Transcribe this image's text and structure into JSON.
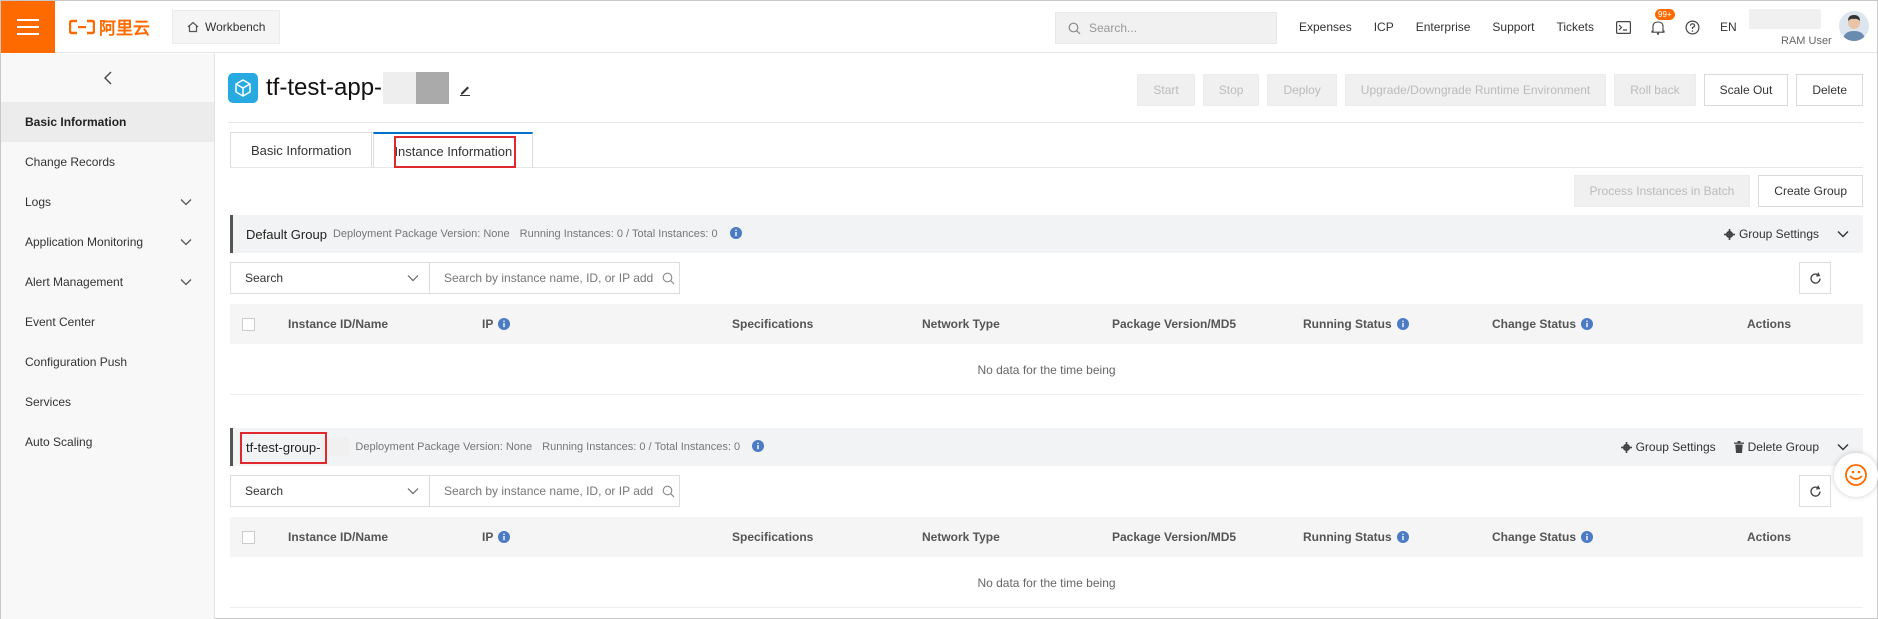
{
  "topbar": {
    "logo_text": "阿里云",
    "workbench": "Workbench",
    "search_placeholder": "Search...",
    "links": [
      "Expenses",
      "ICP",
      "Enterprise",
      "Support",
      "Tickets"
    ],
    "notification_badge": "99+",
    "language": "EN",
    "user_label": "RAM User",
    "brand_color": "#ff6a00"
  },
  "sidebar": {
    "items": [
      {
        "label": "Basic Information",
        "active": true
      },
      {
        "label": "Change Records"
      },
      {
        "label": "Logs",
        "expandable": true
      },
      {
        "label": "Application Monitoring",
        "expandable": true
      },
      {
        "label": "Alert Management",
        "expandable": true
      },
      {
        "label": "Event Center"
      },
      {
        "label": "Configuration Push"
      },
      {
        "label": "Services"
      },
      {
        "label": "Auto Scaling"
      }
    ]
  },
  "header": {
    "app_title": "tf-test-app-",
    "buttons": {
      "start": "Start",
      "stop": "Stop",
      "deploy": "Deploy",
      "upgrade": "Upgrade/Downgrade Runtime Environment",
      "rollback": "Roll back",
      "scale_out": "Scale Out",
      "delete": "Delete"
    }
  },
  "tabs": [
    {
      "label": "Basic Information"
    },
    {
      "label": "Instance Information",
      "active": true
    }
  ],
  "group_actions": {
    "process_batch": "Process Instances in Batch",
    "create_group": "Create Group"
  },
  "groups": [
    {
      "name": "Default Group",
      "package_version": "Deployment Package Version: None",
      "instances": "Running Instances: 0 / Total Instances: 0",
      "settings": "Group Settings",
      "filter_select": "Search",
      "filter_placeholder": "Search by instance name, ID, or IP add",
      "empty_text": "No data for the time being"
    },
    {
      "name": "tf-test-group-",
      "package_version": "Deployment Package Version: None",
      "instances": "Running Instances: 0 / Total Instances: 0",
      "settings": "Group Settings",
      "delete": "Delete Group",
      "filter_select": "Search",
      "filter_placeholder": "Search by instance name, ID, or IP add",
      "empty_text": "No data for the time being"
    }
  ],
  "table_columns": [
    "Instance ID/Name",
    "IP",
    "Specifications",
    "Network Type",
    "Package Version/MD5",
    "Running Status",
    "Change Status",
    "Actions"
  ]
}
